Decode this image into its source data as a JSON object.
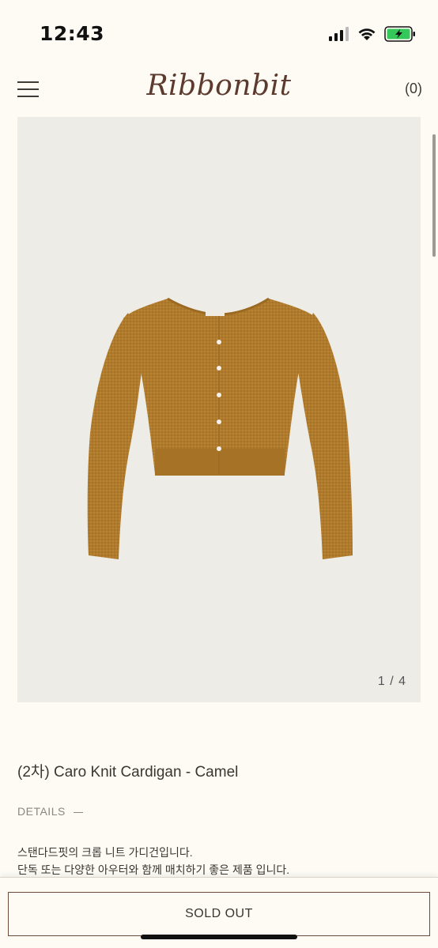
{
  "status": {
    "time": "12:43",
    "battery_color": "#34c759"
  },
  "header": {
    "logo": "Ribbonbit",
    "cart_count": "(0)"
  },
  "gallery": {
    "counter": "1 / 4",
    "garment_color": "#b07a2c",
    "button_color": "#f4f0ea"
  },
  "product": {
    "title": "(2차) Caro Knit Cardigan - Camel",
    "details_label": "DETAILS",
    "description_line1": "스탠다드핏의 크롭 니트 가디건입니다.",
    "description_line2": "단독 또는 다양한 아우터와 함께 매치하기 좋은 제품 입니다."
  },
  "actions": {
    "soldout_label": "SOLD OUT"
  }
}
